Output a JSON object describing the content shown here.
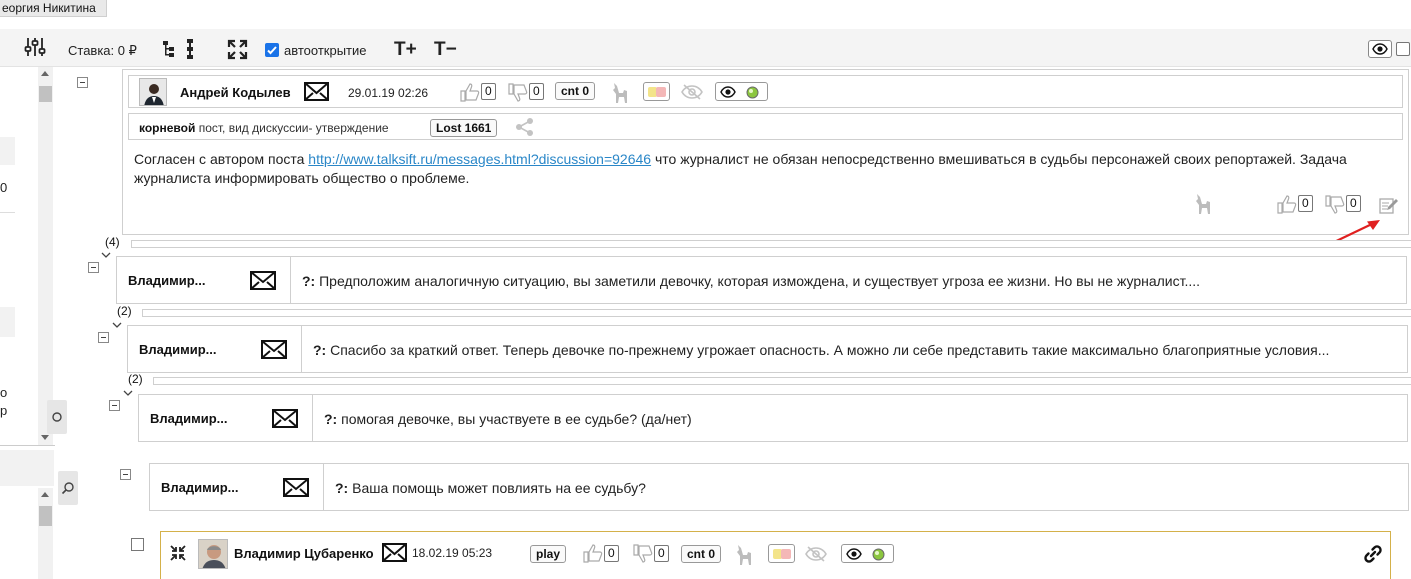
{
  "top_tab": {
    "label": "еоргия Никитина"
  },
  "toolbar": {
    "stake_label": "Ставка: 0 ₽",
    "autoopen_label": "автооткрытие",
    "autoopen_checked": true,
    "font_plus": "T+",
    "font_minus": "T−"
  },
  "left_pane": {
    "frag_1": "0",
    "frag_2": "о",
    "frag_3": "р"
  },
  "root_post": {
    "author": "Андрей Кодылев",
    "date": "29.01.19 02:26",
    "likes": "0",
    "dislikes": "0",
    "cnt_label": "cnt 0",
    "meta_strong": "корневой",
    "meta_rest": " пост, вид дискуссии- утверждение",
    "lost_label": "Lost 1661",
    "body_before": "Согласен с автором поста ",
    "body_link": "http://www.talksift.ru/messages.html?discussion=92646",
    "body_after": " что журналист не обязан непосредственно вмешиваться в судьбы персонажей своих репортажей. Задача журналиста информировать общество о проблеме.",
    "footer_likes": "0",
    "footer_dislikes": "0"
  },
  "thread": [
    {
      "count": "(4)",
      "author": "Владимир...",
      "prefix": "?:",
      "text": " Предположим аналогичную ситуацию, вы заметили девочку, которая измождена, и существует угроза ее жизни. Но вы не журналист...."
    },
    {
      "count": "(2)",
      "author": "Владимир...",
      "prefix": "?:",
      "text": " Спасибо за краткий ответ. Теперь девочке по-прежнему угрожает опасность. А можно ли себе представить такие максимально благоприятные условия..."
    },
    {
      "count": "(2)",
      "author": "Владимир...",
      "prefix": "?:",
      "text": " помогая девочке, вы участвуете в ее судьбе? (да/нет)"
    },
    {
      "count": "",
      "author": "Владимир...",
      "prefix": "?:",
      "text": " Ваша помощь может повлиять на ее судьбу?"
    }
  ],
  "last_post": {
    "author": "Владимир Цубаренко",
    "date": "18.02.19 05:23",
    "play_label": "play",
    "likes": "0",
    "dislikes": "0",
    "cnt_label": "cnt 0"
  },
  "colors": {
    "accent_border": "#d4b14a",
    "link": "#2a87c8",
    "checkbox": "#1a73e8",
    "arrow": "#e02020"
  }
}
